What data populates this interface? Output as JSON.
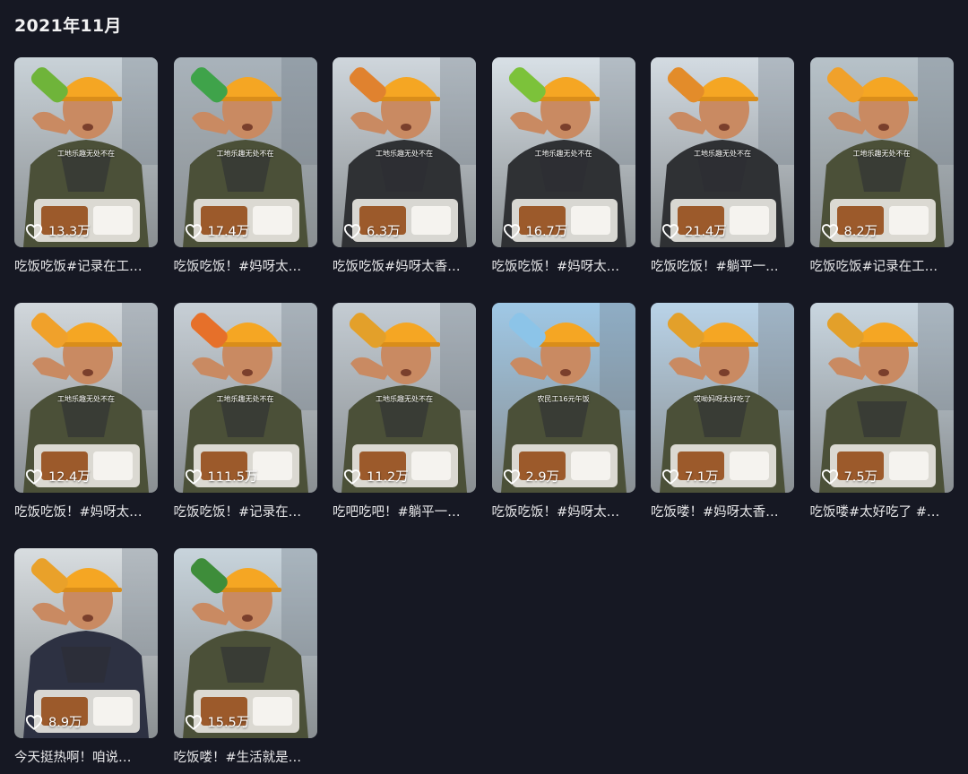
{
  "section": {
    "title": "2021年11月"
  },
  "videos": [
    {
      "likes": "13.3万",
      "caption": "吃饭吃饭#记录在工…",
      "overlay": "工地乐趣无处不在",
      "shirt": "#4b5038",
      "bottle": "#6fb43a",
      "sky": "#c9d2d8"
    },
    {
      "likes": "17.4万",
      "caption": "吃饭吃饭！#妈呀太…",
      "overlay": "工地乐趣无处不在",
      "shirt": "#4b5038",
      "bottle": "#3fa34a",
      "sky": "#a9b3bb"
    },
    {
      "likes": "6.3万",
      "caption": "吃饭吃饭#妈呀太香…",
      "overlay": "工地乐趣无处不在",
      "shirt": "#2f3134",
      "bottle": "#e0822f",
      "sky": "#cfd6dc"
    },
    {
      "likes": "16.7万",
      "caption": "吃饭吃饭！#妈呀太…",
      "overlay": "工地乐趣无处不在",
      "shirt": "#2f3134",
      "bottle": "#7cc23a",
      "sky": "#d8e0e6"
    },
    {
      "likes": "21.4万",
      "caption": "吃饭吃饭！#躺平一…",
      "overlay": "工地乐趣无处不在",
      "shirt": "#2f3134",
      "bottle": "#e38c2a",
      "sky": "#d3dbe2"
    },
    {
      "likes": "8.2万",
      "caption": "吃饭吃饭#记录在工…",
      "overlay": "工地乐趣无处不在",
      "shirt": "#4b5038",
      "bottle": "#f0a12b",
      "sky": "#b7c2c9"
    },
    {
      "likes": "12.4万",
      "caption": "吃饭吃饭！#妈呀太…",
      "overlay": "工地乐趣无处不在",
      "shirt": "#4b5038",
      "bottle": "#f0a12b",
      "sky": "#d1d7dc"
    },
    {
      "likes": "111.5万",
      "caption": "吃饭吃饭！#记录在…",
      "overlay": "工地乐趣无处不在",
      "shirt": "#4b5038",
      "bottle": "#e6702a",
      "sky": "#c7cfd6"
    },
    {
      "likes": "11.2万",
      "caption": "吃吧吃吧！#躺平一…",
      "overlay": "工地乐趣无处不在",
      "shirt": "#4b5038",
      "bottle": "#e3a02a",
      "sky": "#c4ccd3"
    },
    {
      "likes": "2.9万",
      "caption": "吃饭吃饭！#妈呀太…",
      "overlay": "农民工16元午饭",
      "shirt": "#4b5038",
      "bottle": "#8cc4e8",
      "sky": "#9fc8e6"
    },
    {
      "likes": "7.1万",
      "caption": "吃饭喽！#妈呀太香…",
      "overlay": "哎呦妈呀太好吃了",
      "shirt": "#4b5038",
      "bottle": "#e3a02a",
      "sky": "#b9d3e8"
    },
    {
      "likes": "7.5万",
      "caption": "吃饭喽#太好吃了 #…",
      "overlay": "",
      "shirt": "#4b5038",
      "bottle": "#e3a02a",
      "sky": "#c9d6e0"
    },
    {
      "likes": "8.9万",
      "caption": "今天挺热啊！咱说…",
      "overlay": "",
      "shirt": "#2d3142",
      "bottle": "#e9a12a",
      "sky": "#d8dde0"
    },
    {
      "likes": "15.5万",
      "caption": "吃饭喽！#生活就是…",
      "overlay": "",
      "shirt": "#4b5038",
      "bottle": "#3e8d3a",
      "sky": "#c8d4dc"
    }
  ],
  "colors": {
    "background": "#161823",
    "helmet": "#f5a623",
    "skin": "#c98a62",
    "food_box": "#e7e5e0"
  }
}
